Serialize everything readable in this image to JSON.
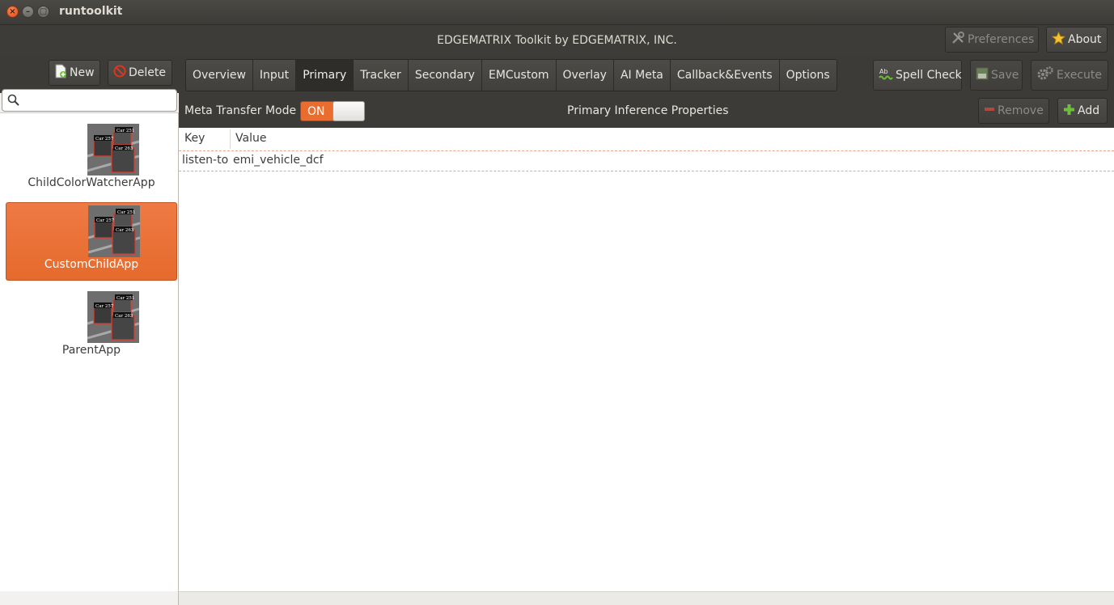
{
  "window": {
    "title": "runtoolkit",
    "close_glyph": "×",
    "minimize_glyph": "–",
    "maximize_glyph": "□"
  },
  "header": {
    "title": "EDGEMATRIX Toolkit by EDGEMATRIX, INC.",
    "preferences_label": "Preferences",
    "about_label": "About"
  },
  "left_toolbar": {
    "new_label": "New",
    "delete_label": "Delete"
  },
  "search": {
    "placeholder": "",
    "value": ""
  },
  "apps": [
    {
      "label": "ChildColorWatcherApp",
      "selected": false,
      "thumb_tags": [
        "Car 257",
        "Car 251",
        "Car 263"
      ]
    },
    {
      "label": "CustomChildApp",
      "selected": true,
      "thumb_tags": [
        "Car 257",
        "Car 251",
        "Car 263"
      ]
    },
    {
      "label": "ParentApp",
      "selected": false,
      "thumb_tags": [
        "Car 257",
        "Car 251",
        "Car 263"
      ]
    }
  ],
  "tabs": [
    {
      "label": "Overview",
      "active": false
    },
    {
      "label": "Input",
      "active": false
    },
    {
      "label": "Primary",
      "active": true
    },
    {
      "label": "Tracker",
      "active": false
    },
    {
      "label": "Secondary",
      "active": false
    },
    {
      "label": "EMCustom",
      "active": false
    },
    {
      "label": "Overlay",
      "active": false
    },
    {
      "label": "AI Meta",
      "active": false
    },
    {
      "label": "Callback&Events",
      "active": false
    },
    {
      "label": "Options",
      "active": false
    }
  ],
  "actions": {
    "spell_check_label": "Spell Check",
    "save_label": "Save",
    "execute_label": "Execute"
  },
  "properties": {
    "meta_transfer_label": "Meta Transfer Mode",
    "meta_transfer_state": "ON",
    "title": "Primary Inference Properties",
    "remove_label": "Remove",
    "add_label": "Add"
  },
  "table": {
    "columns": [
      "Key",
      "Value"
    ],
    "rows": [
      {
        "key": "listen-to",
        "value": "emi_vehicle_dcf"
      }
    ]
  },
  "colors": {
    "accent": "#e96d2f",
    "header_bg": "#3c3b37",
    "selection": "#ec7440"
  }
}
